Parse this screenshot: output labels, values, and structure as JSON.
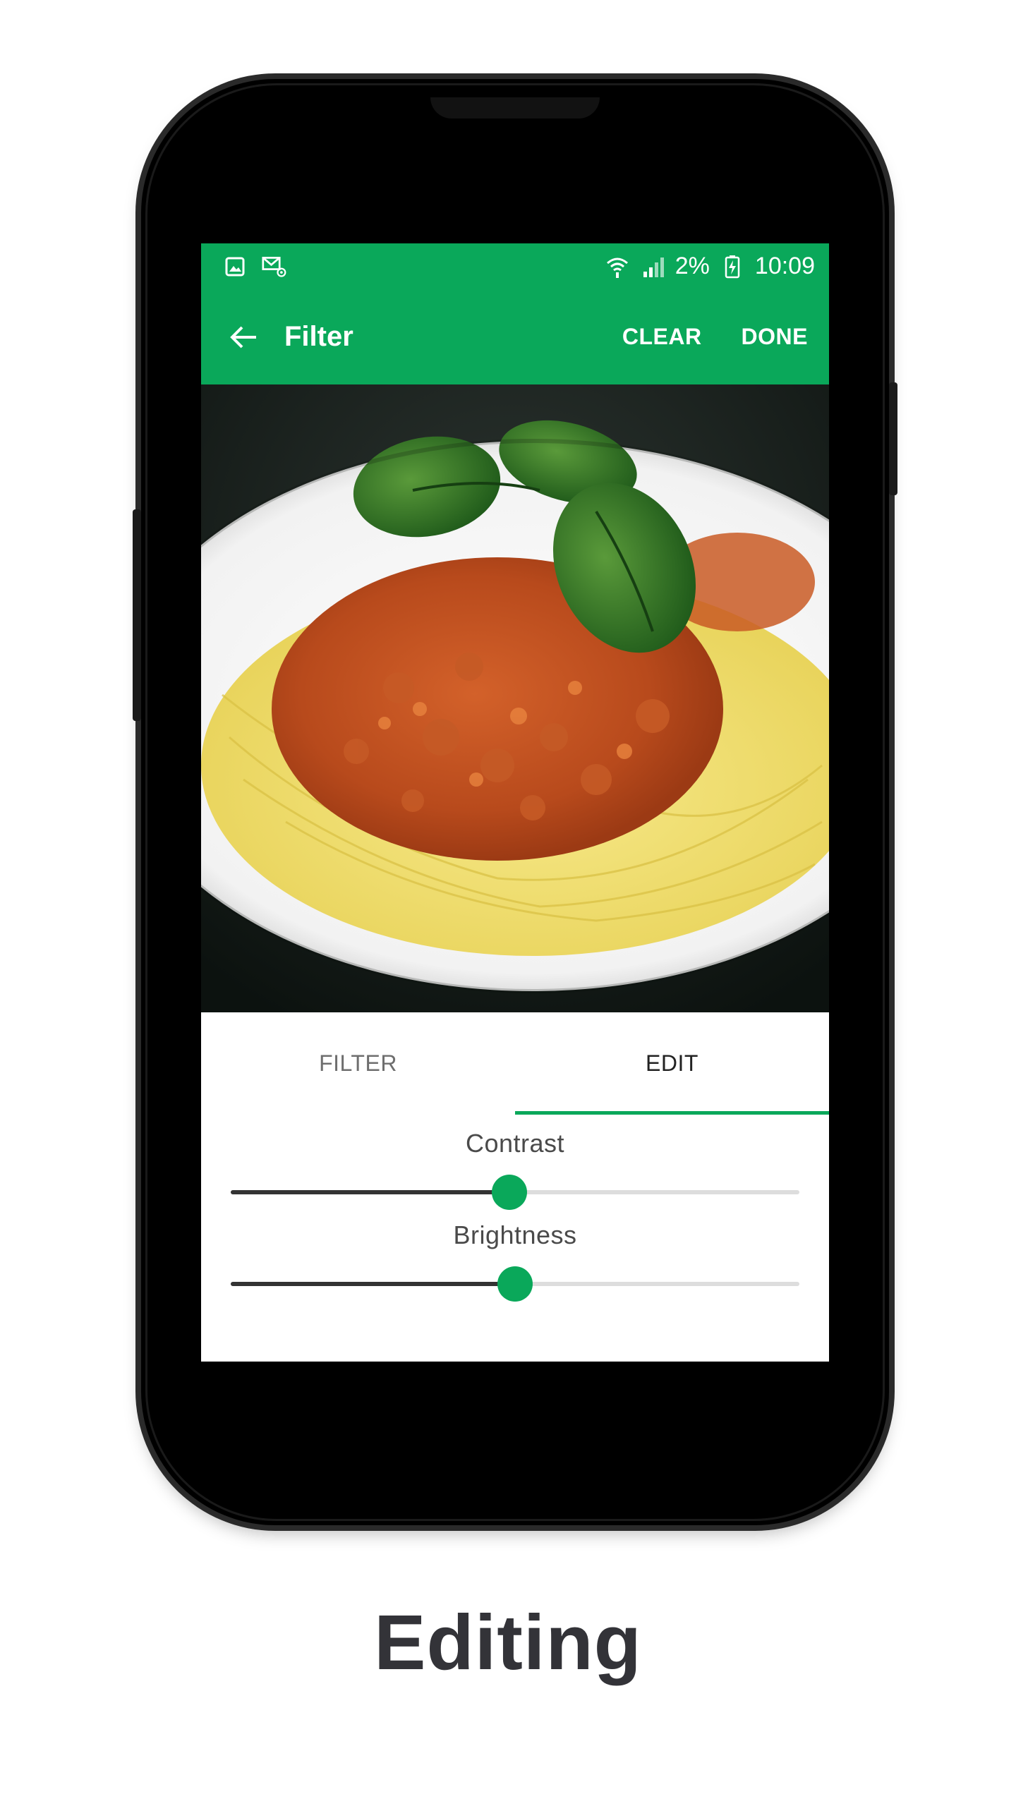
{
  "status_bar": {
    "battery": "2%",
    "time": "10:09",
    "icons": [
      "gallery-icon",
      "email-notification-icon",
      "wifi-icon",
      "signal-icon",
      "battery-charging-icon"
    ]
  },
  "app_bar": {
    "title": "Filter",
    "clear_label": "CLEAR",
    "done_label": "DONE",
    "background": "#0aa85a"
  },
  "photo": {
    "subject": "spaghetti bolognese with basil"
  },
  "tabs": [
    {
      "label": "FILTER",
      "active": false
    },
    {
      "label": "EDIT",
      "active": true
    }
  ],
  "editor": {
    "contrast": {
      "label": "Contrast",
      "value": 0.49
    },
    "brightness": {
      "label": "Brightness",
      "value": 0.5
    }
  },
  "caption": "Editing",
  "colors": {
    "accent": "#0aa85a",
    "slider_fill": "#333333",
    "slider_track": "#dddddd"
  }
}
